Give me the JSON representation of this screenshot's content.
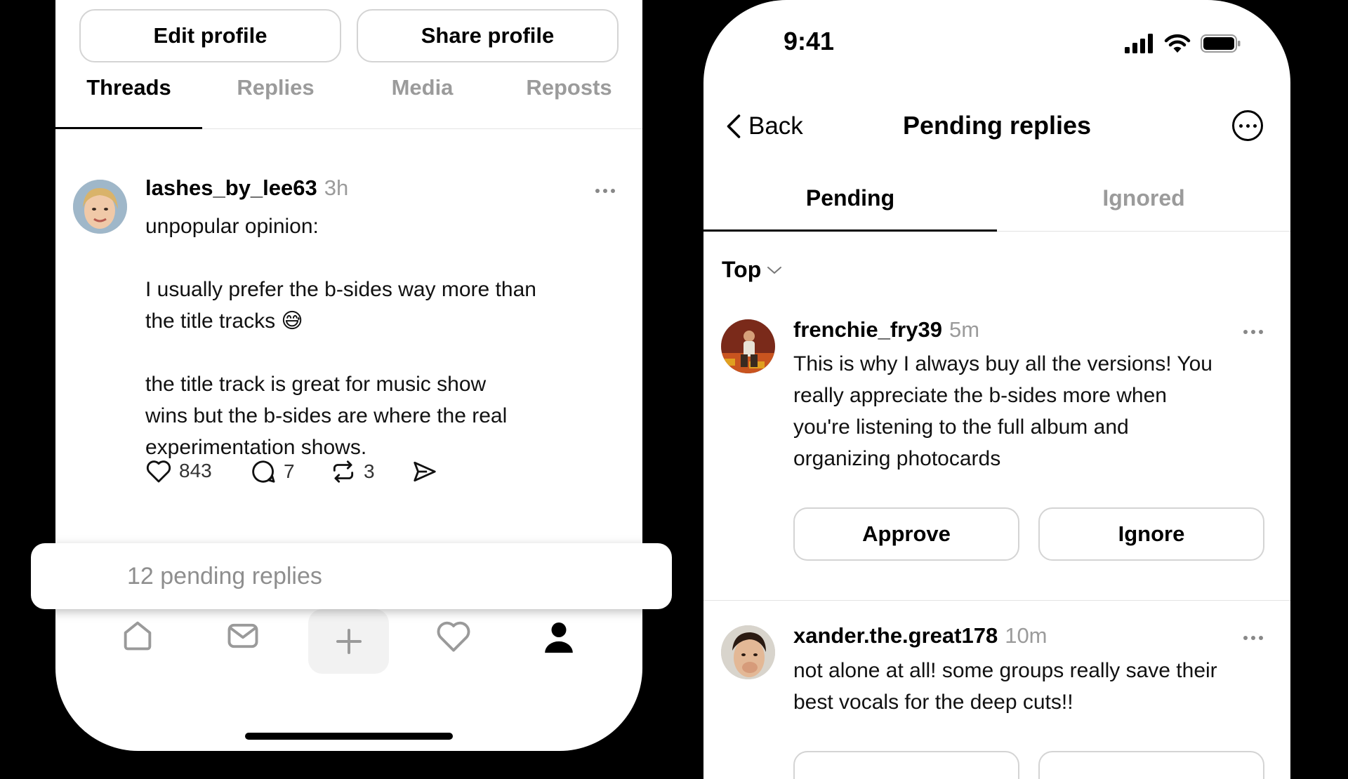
{
  "left_screen": {
    "profile_buttons": {
      "edit": "Edit profile",
      "share": "Share profile"
    },
    "tabs": [
      {
        "label": "Threads",
        "active": true
      },
      {
        "label": "Replies",
        "active": false
      },
      {
        "label": "Media",
        "active": false
      },
      {
        "label": "Reposts",
        "active": false
      }
    ],
    "post": {
      "username": "lashes_by_lee63",
      "time": "3h",
      "lines": [
        "unpopular opinion:",
        "",
        "I usually prefer the b-sides way more than",
        "the title tracks 😅",
        "",
        "the title track is great for music show",
        "wins but the b-sides are  where the real",
        "experimentation shows."
      ],
      "likes": "843",
      "comments": "7",
      "reposts": "3"
    },
    "pending_banner": "12 pending replies",
    "bottom_nav": [
      "home-icon",
      "inbox-icon",
      "plus-icon",
      "heart-icon",
      "profile-icon"
    ]
  },
  "right_screen": {
    "status_bar": {
      "time": "9:41"
    },
    "nav": {
      "back_label": "Back",
      "title": "Pending replies"
    },
    "tabs": [
      {
        "label": "Pending",
        "active": true
      },
      {
        "label": "Ignored",
        "active": false
      }
    ],
    "sort_label": "Top",
    "replies": [
      {
        "username": "frenchie_fry39",
        "time": "5m",
        "lines": [
          "This is why I always buy all the versions! You",
          "really appreciate the b-sides more when",
          "you're listening to the full album and",
          "organizing photocards"
        ],
        "approve_label": "Approve",
        "ignore_label": "Ignore"
      },
      {
        "username": "xander.the.great178",
        "time": "10m",
        "lines": [
          "not alone at all! some groups really save their",
          "best vocals for the deep cuts!!"
        ]
      }
    ]
  }
}
